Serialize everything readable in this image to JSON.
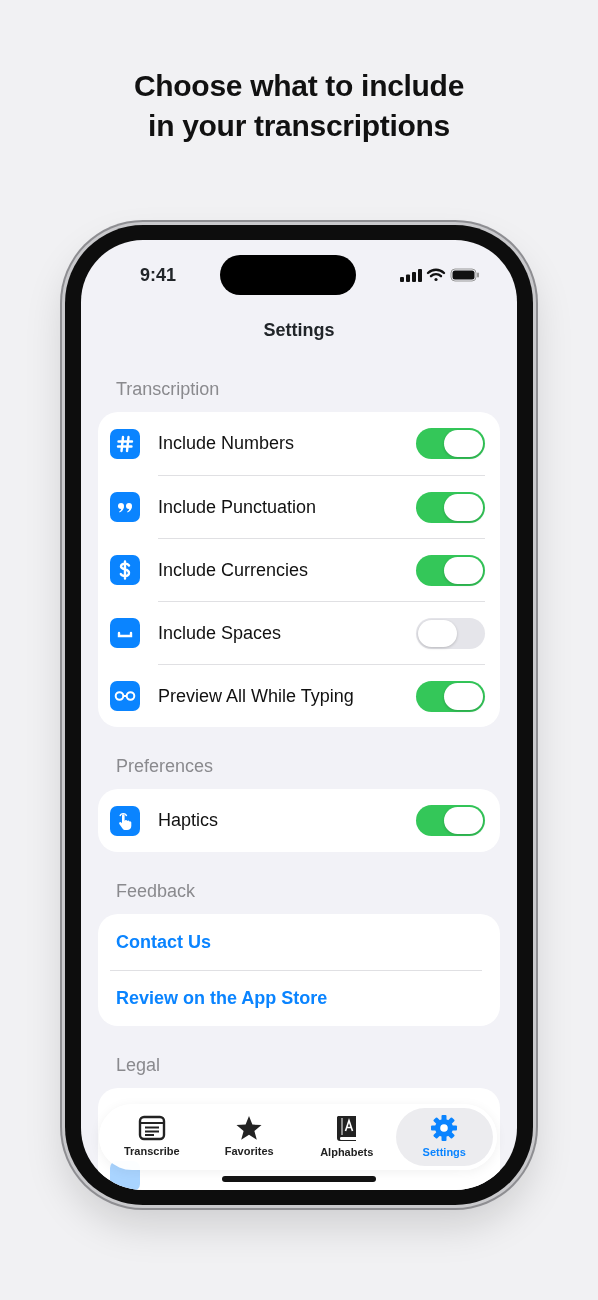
{
  "headline": "Choose what to include\nin your transcriptions",
  "status_bar": {
    "time": "9:41"
  },
  "title": "Settings",
  "sections": [
    {
      "header": "Transcription",
      "items": [
        {
          "kind": "toggle",
          "label": "Include Numbers",
          "on": true
        },
        {
          "kind": "toggle",
          "label": "Include Punctuation",
          "on": true
        },
        {
          "kind": "toggle",
          "label": "Include Currencies",
          "on": true
        },
        {
          "kind": "toggle",
          "label": "Include Spaces",
          "on": false
        },
        {
          "kind": "toggle",
          "label": "Preview All While Typing",
          "on": true
        }
      ]
    },
    {
      "header": "Preferences",
      "items": [
        {
          "kind": "toggle",
          "label": "Haptics",
          "on": true
        }
      ]
    },
    {
      "header": "Feedback",
      "items": [
        {
          "kind": "link",
          "label": "Contact Us"
        },
        {
          "kind": "link",
          "label": "Review on the App Store"
        }
      ]
    },
    {
      "header": "Legal",
      "items": [
        {
          "kind": "hidden"
        },
        {
          "kind": "faded"
        }
      ]
    }
  ],
  "tabs": [
    {
      "label": "Transcribe",
      "selected": false
    },
    {
      "label": "Favorites",
      "selected": false
    },
    {
      "label": "Alphabets",
      "selected": false
    },
    {
      "label": "Settings",
      "selected": true
    }
  ]
}
